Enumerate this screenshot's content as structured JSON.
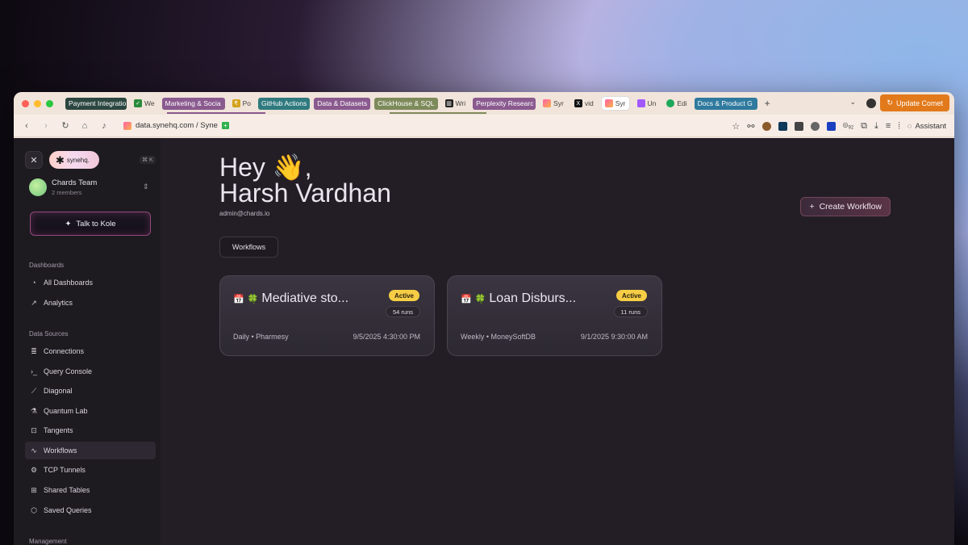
{
  "browser": {
    "tabs": [
      {
        "label": "Payment Integratio",
        "color": "#2c4640"
      },
      {
        "label": "We",
        "color": ""
      },
      {
        "label": "Marketing & Socia",
        "color": "#8a5a8f"
      },
      {
        "label": "Po",
        "color": ""
      },
      {
        "label": "GitHub Actions",
        "color": "#2f7a7e"
      },
      {
        "label": "Data & Datasets",
        "color": "#8a5a8f"
      },
      {
        "label": "ClickHouse & SQL",
        "color": "#7d8a5a"
      },
      {
        "label": "Wri",
        "color": ""
      },
      {
        "label": "Perplexity Researc",
        "color": "#8a5a8f"
      },
      {
        "label": "Syr",
        "color": ""
      },
      {
        "label": "vid",
        "color": ""
      },
      {
        "label": "Syr",
        "color": ""
      },
      {
        "label": "Un",
        "color": ""
      },
      {
        "label": "Edi",
        "color": ""
      },
      {
        "label": "Docs & Product G",
        "color": "#2f7a9e"
      }
    ],
    "update_label": "Update Comet",
    "url": "data.synehq.com / Syne",
    "assistant_label": "Assistant",
    "ext_badge": "92"
  },
  "sidebar": {
    "logo_text": "synehq.",
    "shortcut": "⌘ K",
    "team_name": "Chards Team",
    "team_members": "2 members",
    "talk_label": "Talk to Kole",
    "sections": {
      "dashboards": "Dashboards",
      "data_sources": "Data Sources",
      "management": "Management"
    },
    "items": [
      {
        "label": "All Dashboards",
        "icon": "pie-chart-icon"
      },
      {
        "label": "Analytics",
        "icon": "line-chart-icon"
      },
      {
        "label": "Connections",
        "icon": "database-icon"
      },
      {
        "label": "Query Console",
        "icon": "terminal-icon"
      },
      {
        "label": "Diagonal",
        "icon": "ruler-icon"
      },
      {
        "label": "Quantum Lab",
        "icon": "flask-icon"
      },
      {
        "label": "Tangents",
        "icon": "tangent-icon"
      },
      {
        "label": "Workflows",
        "icon": "workflow-icon"
      },
      {
        "label": "TCP Tunnels",
        "icon": "tunnel-icon"
      },
      {
        "label": "Shared Tables",
        "icon": "shared-icon"
      },
      {
        "label": "Saved Queries",
        "icon": "box-icon"
      }
    ]
  },
  "main": {
    "greeting_line1": "Hey 👋,",
    "greeting_line2": "Harsh Vardhan",
    "email": "admin@chards.io",
    "create_label": "Create Workflow",
    "tab_label": "Workflows",
    "cards": [
      {
        "title": "Mediative sto...",
        "status": "Active",
        "runs": "54 runs",
        "meta": "Daily • Pharmesy",
        "time": "9/5/2025 4:30:00 PM"
      },
      {
        "title": "Loan Disburs...",
        "status": "Active",
        "runs": "11 runs",
        "meta": "Weekly • MoneySoftDB",
        "time": "9/1/2025 9:30:00 AM"
      }
    ]
  }
}
